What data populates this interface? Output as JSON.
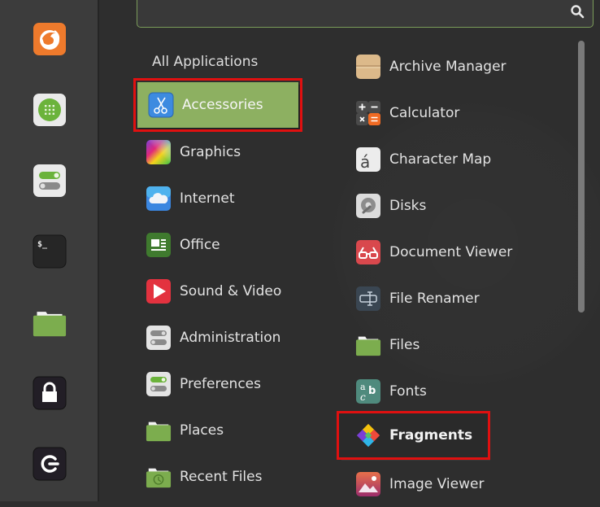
{
  "favorites": [
    {
      "name": "firefox",
      "icon": "firefox-icon"
    },
    {
      "name": "software-manager",
      "icon": "software-manager-icon"
    },
    {
      "name": "system-settings",
      "icon": "settings-toggle-icon"
    },
    {
      "name": "terminal",
      "icon": "terminal-icon",
      "glyph": "$_"
    },
    {
      "name": "files",
      "icon": "folder-icon"
    },
    {
      "name": "lock-screen",
      "icon": "lock-icon"
    },
    {
      "name": "logout",
      "icon": "power-icon"
    }
  ],
  "search": {
    "value": "",
    "placeholder": ""
  },
  "categories": {
    "header": "All Applications",
    "items": [
      {
        "label": "Accessories",
        "icon": "scissors-icon",
        "selected": true
      },
      {
        "label": "Graphics",
        "icon": "graphics-icon"
      },
      {
        "label": "Internet",
        "icon": "cloud-icon"
      },
      {
        "label": "Office",
        "icon": "office-icon"
      },
      {
        "label": "Sound & Video",
        "icon": "play-icon"
      },
      {
        "label": "Administration",
        "icon": "admin-toggle-icon"
      },
      {
        "label": "Preferences",
        "icon": "preferences-toggle-icon"
      },
      {
        "label": "Places",
        "icon": "folder-icon"
      },
      {
        "label": "Recent Files",
        "icon": "recent-folder-icon"
      }
    ]
  },
  "apps": [
    {
      "label": "Archive Manager",
      "icon": "archive-icon"
    },
    {
      "label": "Calculator",
      "icon": "calculator-icon"
    },
    {
      "label": "Character Map",
      "icon": "character-map-icon",
      "glyph": "á"
    },
    {
      "label": "Disks",
      "icon": "disk-icon"
    },
    {
      "label": "Document Viewer",
      "icon": "document-viewer-icon"
    },
    {
      "label": "File Renamer",
      "icon": "file-renamer-icon"
    },
    {
      "label": "Files",
      "icon": "folder-icon"
    },
    {
      "label": "Fonts",
      "icon": "fonts-icon",
      "glyph_top": "a",
      "glyph_small": "b",
      "glyph_bottom": "c"
    },
    {
      "label": "Fragments",
      "icon": "fragments-icon",
      "highlighted": true
    },
    {
      "label": "Image Viewer",
      "icon": "image-viewer-icon"
    }
  ],
  "colors": {
    "accent": "#8db061",
    "highlight_outline": "#e01010",
    "search_border": "#7b9c5a"
  }
}
